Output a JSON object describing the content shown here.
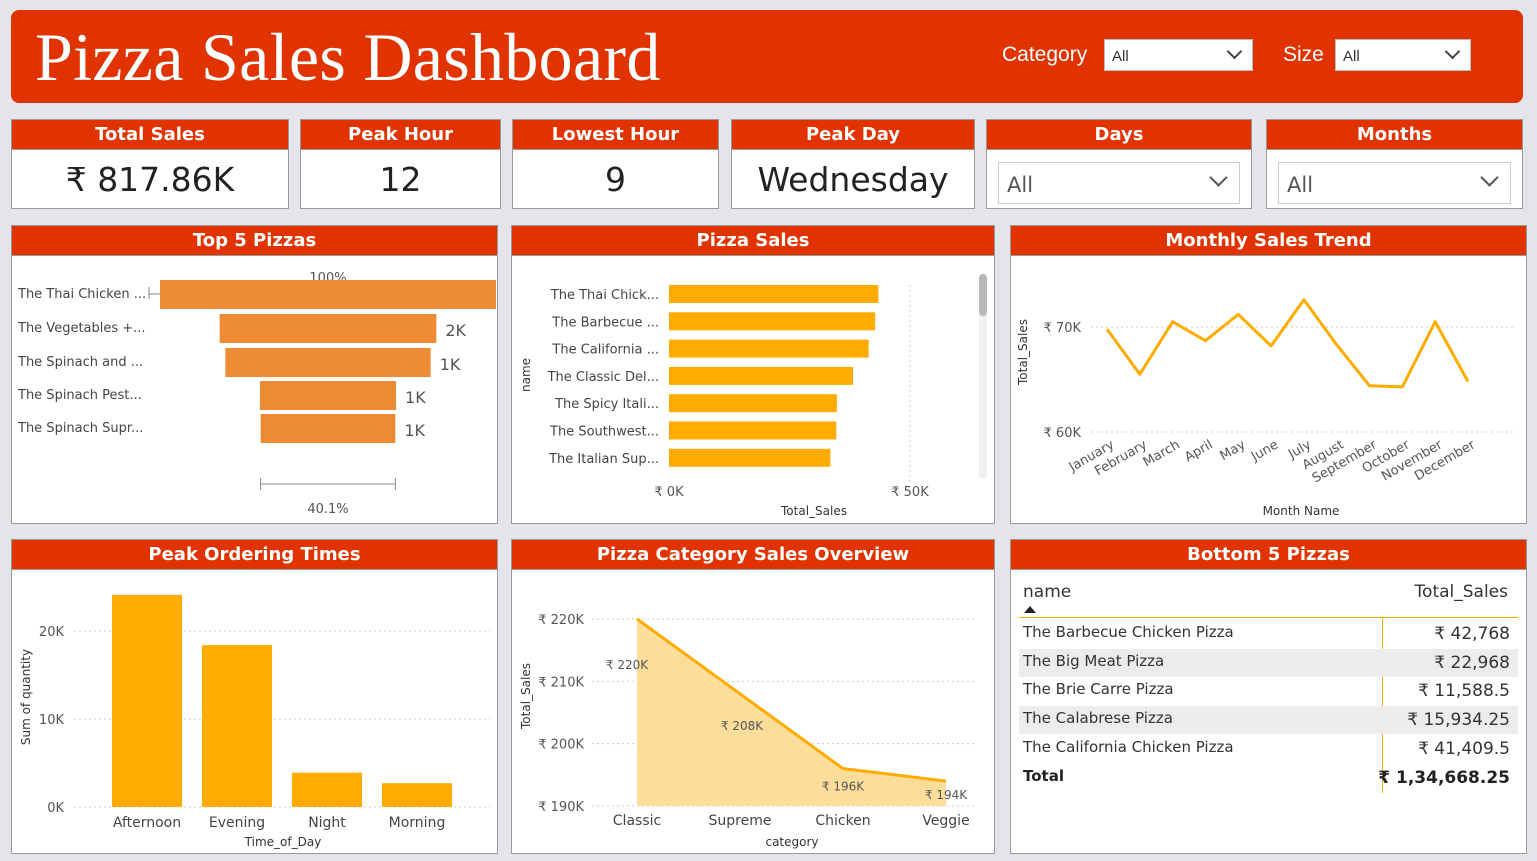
{
  "header": {
    "title": "Pizza Sales Dashboard",
    "category_label": "Category",
    "category_value": "All",
    "size_label": "Size",
    "size_value": "All"
  },
  "kpis": {
    "total_sales": {
      "label": "Total Sales",
      "value": "₹ 817.86K"
    },
    "peak_hour": {
      "label": "Peak Hour",
      "value": "12"
    },
    "lowest_hour": {
      "label": "Lowest Hour",
      "value": "9"
    },
    "peak_day": {
      "label": "Peak Day",
      "value": "Wednesday"
    }
  },
  "slicers": {
    "days": {
      "label": "Days",
      "value": "All"
    },
    "months": {
      "label": "Months",
      "value": "All"
    }
  },
  "top5": {
    "title": "Top 5 Pizzas",
    "top_pct": "100%",
    "bottom_pct": "40.1%",
    "color": "#ee8c35"
  },
  "pizza_sales": {
    "title": "Pizza Sales",
    "color": "#ffab00"
  },
  "monthly": {
    "title": "Monthly Sales Trend",
    "color": "#ffab00"
  },
  "peak_times": {
    "title": "Peak Ordering Times",
    "color": "#ffab00"
  },
  "category_overview": {
    "title": "Pizza Category Sales Overview",
    "color": "#ffab00",
    "fill": "#fddd9a"
  },
  "bottom5": {
    "title": "Bottom 5 Pizzas",
    "columns": [
      "name",
      "Total_Sales"
    ],
    "rows": [
      {
        "name": "The Barbecue Chicken Pizza",
        "sales": "₹ 42,768"
      },
      {
        "name": "The Big Meat Pizza",
        "sales": "₹ 22,968"
      },
      {
        "name": "The Brie Carre Pizza",
        "sales": "₹ 11,588.5"
      },
      {
        "name": "The Calabrese Pizza",
        "sales": "₹ 15,934.25"
      },
      {
        "name": "The California Chicken Pizza",
        "sales": "₹ 41,409.5"
      }
    ],
    "total_label": "Total",
    "total_value": "₹ 1,34,668.25"
  },
  "chart_data": [
    {
      "id": "top5",
      "type": "bar",
      "title": "Top 5 Pizzas",
      "categories": [
        "The Thai Chicken ...",
        "The Vegetables +...",
        "The Spinach and ...",
        "The Spinach Pest...",
        "The Spinach Supr..."
      ],
      "values": [
        1.0,
        0.645,
        0.611,
        0.405,
        0.401
      ],
      "data_labels": [
        "",
        "2K",
        "1K",
        "1K",
        "1K"
      ],
      "annotations": [
        "100%",
        "40.1%"
      ]
    },
    {
      "id": "pizza_sales",
      "type": "bar",
      "title": "Pizza Sales",
      "xlabel": "Total_Sales",
      "ylabel": "name",
      "categories": [
        "The Thai Chick...",
        "The Barbecue ...",
        "The California ...",
        "The Classic Del...",
        "The Spicy Itali...",
        "The Southwest...",
        "The Italian Sup..."
      ],
      "values": [
        43434,
        42768,
        41410,
        38180,
        34831,
        34706,
        33477
      ],
      "xlim": [
        0,
        50000
      ],
      "xticks": [
        "₹ 0K",
        "₹ 50K"
      ]
    },
    {
      "id": "monthly",
      "type": "line",
      "title": "Monthly Sales Trend",
      "xlabel": "Month Name",
      "ylabel": "Total_Sales",
      "x": [
        "January",
        "February",
        "March",
        "April",
        "May",
        "June",
        "July",
        "August",
        "September",
        "October",
        "November",
        "December"
      ],
      "values": [
        69800,
        65500,
        70500,
        68700,
        71200,
        68200,
        72600,
        68300,
        64400,
        64300,
        70500,
        64800
      ],
      "ylim": [
        60000,
        70000
      ],
      "yticks": [
        "₹ 60K",
        "₹ 70K"
      ]
    },
    {
      "id": "peak_times",
      "type": "bar",
      "title": "Peak Ordering Times",
      "xlabel": "Time_of_Day",
      "ylabel": "Sum of quantity",
      "categories": [
        "Afternoon",
        "Evening",
        "Night",
        "Morning"
      ],
      "values": [
        24100,
        18400,
        3900,
        2700
      ],
      "ylim": [
        0,
        20000
      ],
      "yticks": [
        "0K",
        "10K",
        "20K"
      ]
    },
    {
      "id": "category_overview",
      "type": "area",
      "title": "Pizza Category Sales Overview",
      "xlabel": "category",
      "ylabel": "Total_Sales",
      "categories": [
        "Classic",
        "Supreme",
        "Chicken",
        "Veggie"
      ],
      "values": [
        220000,
        208000,
        196000,
        194000
      ],
      "data_labels": [
        "₹ 220K",
        "₹ 208K",
        "₹ 196K",
        "₹ 194K"
      ],
      "ylim": [
        190000,
        220000
      ],
      "yticks": [
        "₹ 190K",
        "₹ 200K",
        "₹ 210K",
        "₹ 220K"
      ]
    }
  ]
}
